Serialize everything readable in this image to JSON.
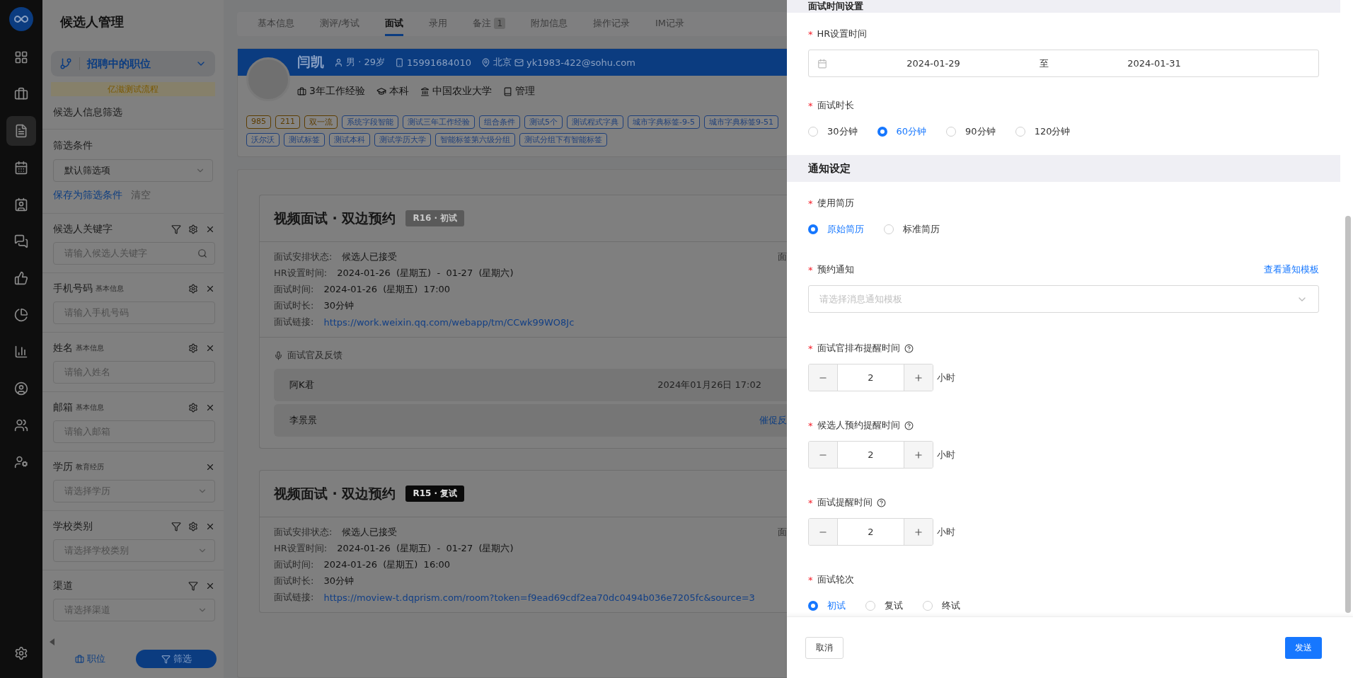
{
  "nav_items": [
    {
      "selected": false
    },
    {
      "selected": false
    },
    {
      "selected": true
    },
    {
      "selected": false
    },
    {
      "selected": false
    },
    {
      "selected": false
    },
    {
      "selected": false
    },
    {
      "selected": false
    },
    {
      "selected": false
    },
    {
      "selected": false
    },
    {
      "selected": false
    },
    {
      "selected": false
    }
  ],
  "filter_panel": {
    "title": "候选人管理",
    "position_selector": "招聘中的职位",
    "process_bar": "亿滋测试流程",
    "section_title": "候选人信息筛选",
    "condition_label": "筛选条件",
    "condition_value": "默认筛选项",
    "save_link": "保存为筛选条件",
    "clear_link": "清空",
    "fields": [
      {
        "label": "候选人关键字",
        "filter": true,
        "settings": true,
        "kind": "search",
        "placeholder": "请输入候选人关键字"
      },
      {
        "label": "手机号码",
        "sub": "基本信息",
        "filter": false,
        "settings": true,
        "kind": "input",
        "placeholder": "请输入手机号码"
      },
      {
        "label": "姓名",
        "sub": "基本信息",
        "filter": false,
        "settings": true,
        "kind": "input",
        "placeholder": "请输入姓名"
      },
      {
        "label": "邮箱",
        "sub": "基本信息",
        "filter": false,
        "settings": true,
        "kind": "input",
        "placeholder": "请输入邮箱"
      },
      {
        "label": "学历",
        "sub": "教育经历",
        "filter": false,
        "settings": false,
        "kind": "select",
        "placeholder": "请选择学历"
      },
      {
        "label": "学校类别",
        "filter": true,
        "settings": true,
        "kind": "select",
        "placeholder": "请选择学校类别"
      },
      {
        "label": "渠道",
        "filter": true,
        "settings": false,
        "kind": "select",
        "placeholder": "请选择渠道"
      }
    ],
    "footer_buttons": [
      {
        "label": "职位",
        "selected": false
      },
      {
        "label": "筛选",
        "selected": true
      }
    ]
  },
  "tabs": [
    {
      "label": "基本信息",
      "selected": false
    },
    {
      "label": "测评/考试",
      "selected": false
    },
    {
      "label": "面试",
      "selected": true
    },
    {
      "label": "录用",
      "selected": false
    },
    {
      "label": "备注",
      "badge": "1",
      "selected": false
    },
    {
      "label": "附加信息",
      "selected": false
    },
    {
      "label": "操作记录",
      "selected": false
    },
    {
      "label": "IM记录",
      "selected": false
    }
  ],
  "candidate": {
    "name": "闫凯",
    "gender_age": "男 · 29岁",
    "phone": "15991684010",
    "city": "北京",
    "email": "yk1983-422@sohu.com",
    "experience": "3年工作经验",
    "degree": "本科",
    "school": "中国农业大学",
    "major": "管理",
    "tags": [
      {
        "label": "985",
        "color": "#5c3c00"
      },
      {
        "label": "211",
        "color": "#5c3c00"
      },
      {
        "label": "双一流",
        "color": "#5c3c00"
      },
      {
        "label": "系统字段智能",
        "color": "#1e3f7a"
      },
      {
        "label": "测试三年工作经验",
        "color": "#1e3f7a"
      },
      {
        "label": "组合条件",
        "color": "#1e3f7a"
      },
      {
        "label": "测试5个",
        "color": "#1e3f7a"
      },
      {
        "label": "测试程式字典",
        "color": "#1e3f7a"
      },
      {
        "label": "城市字典标签-9-5",
        "color": "#1e3f7a"
      },
      {
        "label": "城市字典标签9-51",
        "color": "#1e3f7a"
      },
      {
        "label": "沃尔沃",
        "color": "#1e3f7a"
      },
      {
        "label": "测试标签",
        "color": "#1e3f7a"
      },
      {
        "label": "测试本科",
        "color": "#1e3f7a"
      },
      {
        "label": "测试学历大学",
        "color": "#1e3f7a"
      },
      {
        "label": "智能标签第六级分组",
        "color": "#1e3f7a"
      },
      {
        "label": "测试分组下有智能标签",
        "color": "#1e3f7a"
      }
    ]
  },
  "interviews": [
    {
      "title": "视频面试 · 双边预约",
      "badge": {
        "text": "R16 · 初试",
        "color": "#5a5a5a"
      },
      "right_cut": "面",
      "rows": [
        {
          "label": "面试安排状态:",
          "value": "候选人已接受",
          "kind": "text"
        },
        {
          "label": "HR设置时间:",
          "value": "2024-01-26  (星期五)  -  01-27  (星期六)",
          "kind": "text"
        },
        {
          "label": "面试时间:",
          "value": "2024-01-26  (星期五)  17:00",
          "kind": "text"
        },
        {
          "label": "面试时长:",
          "value": "30分钟",
          "kind": "text"
        },
        {
          "label": "面试链接:",
          "value": "https://work.weixin.qq.com/webapp/tm/CCwk99WO8Jc",
          "kind": "link"
        }
      ],
      "feedback": {
        "title": "面试官及反馈",
        "rows": [
          {
            "name": "阿K君",
            "time": "2024年01月26日 17:02"
          },
          {
            "name": "李景景",
            "action": "催促反"
          }
        ]
      }
    },
    {
      "title": "视频面试 · 双边预约",
      "badge": {
        "text": "R15 · 复试",
        "color": "#0a0a0a"
      },
      "right_cut": "面",
      "rows": [
        {
          "label": "面试安排状态:",
          "value": "候选人已接受",
          "kind": "text"
        },
        {
          "label": "HR设置时间:",
          "value": "2024-01-26  (星期五)  -  01-27  (星期六)",
          "kind": "text"
        },
        {
          "label": "面试时间:",
          "value": "2024-01-26  (星期五)  16:00",
          "kind": "text"
        },
        {
          "label": "面试时长:",
          "value": "30分钟",
          "kind": "text"
        },
        {
          "label": "面试链接:",
          "value": "https://moview-t.dqprism.com/room?token=f9ead69cdf2ea70dc0494b036e7205fc&source=3",
          "kind": "link"
        }
      ]
    }
  ],
  "drawer": {
    "time_section": "面试时间设置",
    "hr_time": {
      "mark": "*",
      "label": "HR设置时间",
      "start": "2024-01-29",
      "separator": "至",
      "end": "2024-01-31"
    },
    "duration": {
      "mark": "*",
      "label": "面试时长",
      "options": [
        {
          "label": "30分钟",
          "selected": false
        },
        {
          "label": "60分钟",
          "selected": true
        },
        {
          "label": "90分钟",
          "selected": false
        },
        {
          "label": "120分钟",
          "selected": false
        }
      ]
    },
    "notify_section": "通知设定",
    "resume": {
      "mark": "*",
      "label": "使用简历",
      "options": [
        {
          "label": "原始简历",
          "selected": true
        },
        {
          "label": "标准简历",
          "selected": false
        }
      ]
    },
    "notice": {
      "mark": "*",
      "label": "预约通知",
      "link": "查看通知模板",
      "placeholder": "请选择消息通知模板"
    },
    "reminders": [
      {
        "mark": "*",
        "label": "面试官排布提醒时间",
        "value": "2",
        "unit": "小时"
      },
      {
        "mark": "*",
        "label": "候选人预约提醒时间",
        "value": "2",
        "unit": "小时"
      },
      {
        "mark": "*",
        "label": "面试提醒时间",
        "value": "2",
        "unit": "小时"
      }
    ],
    "round": {
      "mark": "*",
      "label": "面试轮次",
      "options": [
        {
          "label": "初试",
          "selected": true
        },
        {
          "label": "复试",
          "selected": false
        },
        {
          "label": "终试",
          "selected": false
        }
      ]
    },
    "cancel": "取消",
    "send": "发送"
  }
}
